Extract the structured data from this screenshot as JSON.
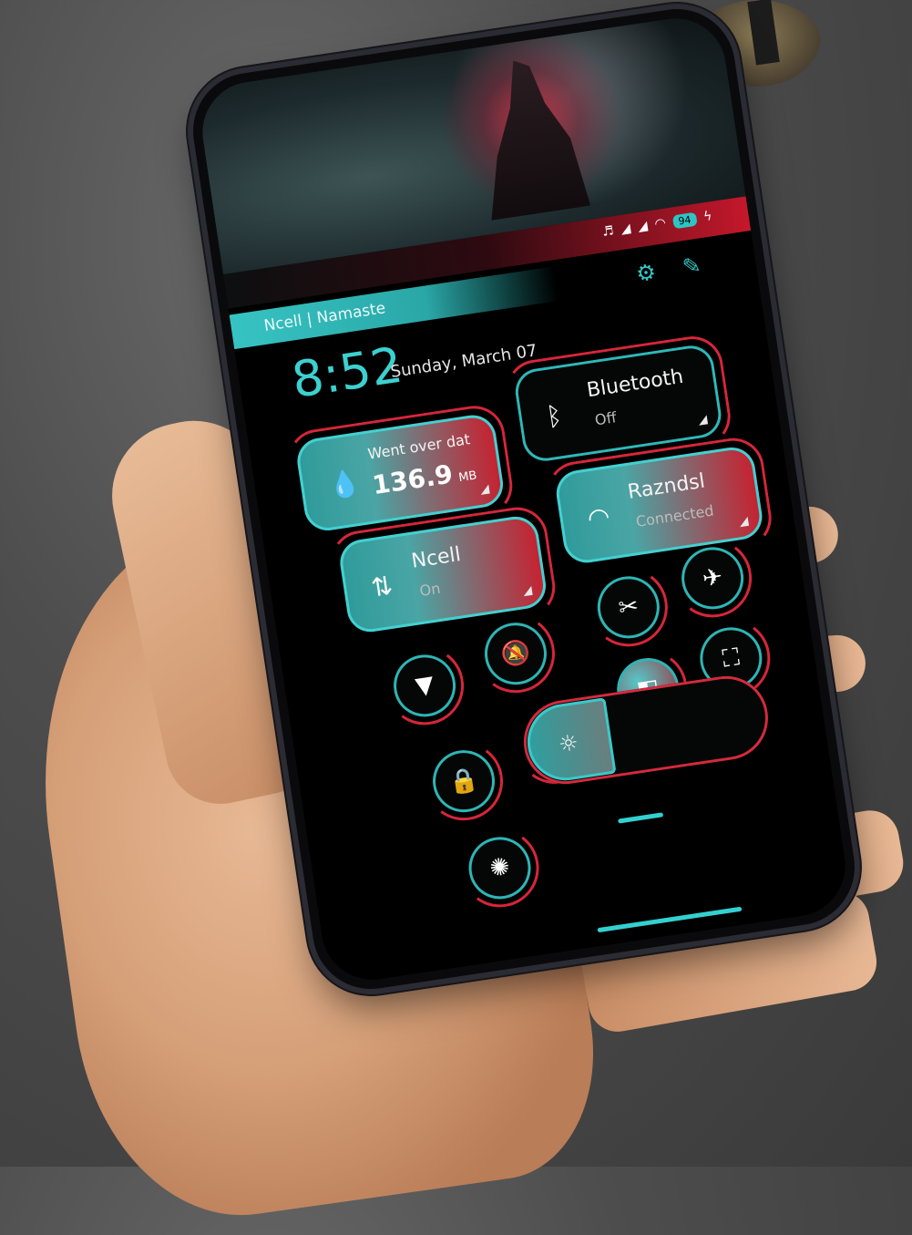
{
  "status_bar": {
    "battery": "94",
    "icons": [
      "headphones-icon",
      "signal-icon",
      "signal-icon",
      "wifi-icon",
      "battery-icon",
      "charging-icon"
    ]
  },
  "header": {
    "carrier_text": "Ncell | Namaste",
    "time": "8:52",
    "date": "Sunday, March 07"
  },
  "tiles": {
    "data": {
      "label": "Went over dat",
      "value": "136.9",
      "unit": "MB",
      "icon": "water-drop-icon"
    },
    "bluetooth": {
      "title": "Bluetooth",
      "status": "Off",
      "icon": "bluetooth-icon"
    },
    "wifi": {
      "title": "Razndsl",
      "status": "Connected",
      "icon": "wifi-icon"
    },
    "mobile": {
      "title": "Ncell",
      "status": "On",
      "icon": "data-transfer-icon"
    }
  },
  "toggles": [
    {
      "name": "screenshot-icon",
      "glyph": "✂"
    },
    {
      "name": "airplane-icon",
      "glyph": "✈"
    },
    {
      "name": "flashlight-icon",
      "glyph": "▼"
    },
    {
      "name": "bell-mute-icon",
      "glyph": "⍁"
    },
    {
      "name": "floating-window-icon",
      "glyph": "◧"
    },
    {
      "name": "scan-icon",
      "glyph": "⌗"
    },
    {
      "name": "lock-icon",
      "glyph": "🔒"
    },
    {
      "name": "location-icon",
      "glyph": "⌖"
    },
    {
      "name": "auto-brightness-icon",
      "glyph": "✺"
    }
  ],
  "brightness": {
    "level": 0.35,
    "icon": "sun-icon"
  },
  "colors": {
    "accent": "#35c6c6",
    "secondary": "#d6263a"
  }
}
